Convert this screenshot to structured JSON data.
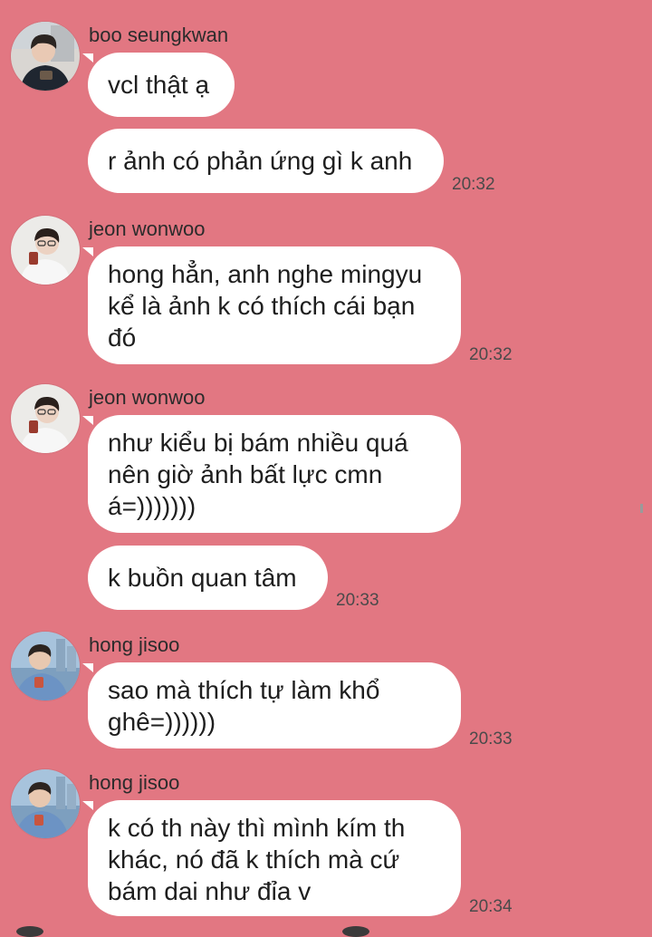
{
  "colors": {
    "background": "#e27782",
    "bubble": "#ffffff",
    "timestamp": "#4a4a4a"
  },
  "messages": [
    {
      "sender": "boo seungkwan",
      "avatar": "avatar-boo-seungkwan",
      "bubbles": [
        {
          "text": "vcl thật ạ"
        },
        {
          "text": "r ảnh có phản ứng gì k anh",
          "time": "20:32"
        }
      ]
    },
    {
      "sender": "jeon wonwoo",
      "avatar": "avatar-jeon-wonwoo",
      "bubbles": [
        {
          "lines": [
            "hong hẳn, anh nghe mingyu",
            "kể là ảnh k có thích cái bạn",
            "đó"
          ],
          "time": "20:32"
        }
      ]
    },
    {
      "sender": "jeon wonwoo",
      "avatar": "avatar-jeon-wonwoo",
      "bubbles": [
        {
          "lines": [
            "như kiểu bị bám nhiều quá",
            "nên giờ ảnh bất lực cmn",
            "á=)))))))"
          ]
        },
        {
          "text": "k buồn quan tâm",
          "time": "20:33"
        }
      ]
    },
    {
      "sender": "hong jisoo",
      "avatar": "avatar-hong-jisoo",
      "bubbles": [
        {
          "lines": [
            "sao mà thích tự làm khổ",
            "ghê=))))))"
          ],
          "time": "20:33"
        }
      ]
    },
    {
      "sender": "hong jisoo",
      "avatar": "avatar-hong-jisoo",
      "bubbles": [
        {
          "lines": [
            "k có th này thì mình kím th",
            "khác, nó đã k thích mà cứ",
            "bám dai như đỉa v"
          ],
          "time": "20:34"
        }
      ]
    }
  ]
}
